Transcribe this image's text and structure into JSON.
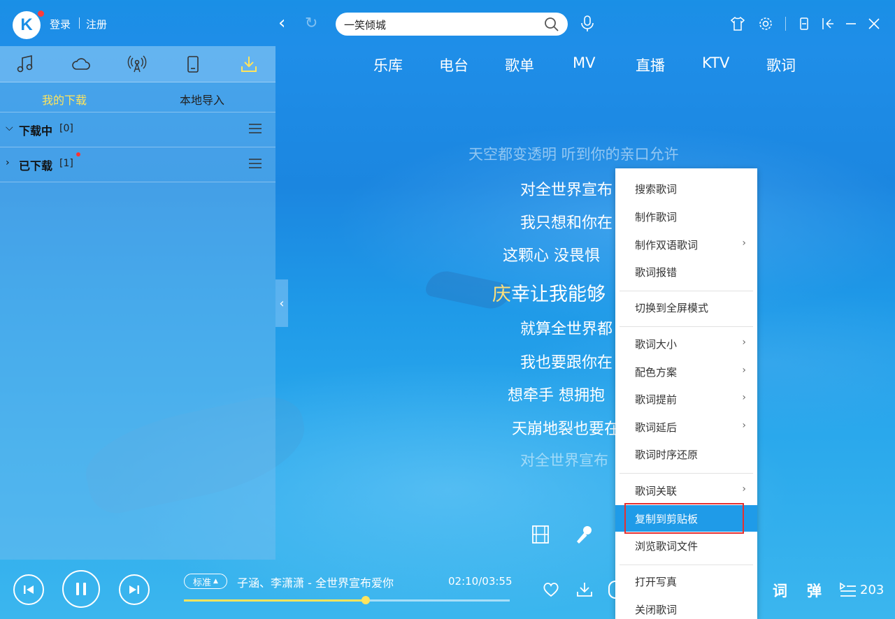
{
  "header": {
    "logo_letter": "K",
    "login": "登录",
    "register": "注册",
    "search": {
      "value": "一笑倾城"
    }
  },
  "left_panel": {
    "tabs": [
      "music-note-icon",
      "cloud-icon",
      "radio-icon",
      "phone-icon",
      "download-icon"
    ],
    "sub_tabs": {
      "my_downloads": "我的下载",
      "local_import": "本地导入"
    },
    "groups": [
      {
        "name": "下载中",
        "count": "[0]"
      },
      {
        "name": "已下载",
        "count": "[1]"
      }
    ]
  },
  "main_nav": [
    "乐库",
    "电台",
    "歌单",
    "MV",
    "直播",
    "KTV",
    "歌词"
  ],
  "lyrics": {
    "line1": "天空都变透明 听到你的亲口允许",
    "line2": "对全世界宣布",
    "line3": "我只想和你在",
    "line4": "这颗心 没畏惧",
    "current_hl": "庆",
    "current_rest": "幸让我能够",
    "line6": "就算全世界都",
    "line7": "我也要跟你在",
    "line8": "想牵手 想拥抱",
    "line9": "天崩地裂也要在",
    "line10": "对全世界宣布"
  },
  "context_menu": {
    "items": [
      "搜索歌词",
      "制作歌词",
      "制作双语歌词",
      "歌词报错",
      "切换到全屏模式",
      "歌词大小",
      "配色方案",
      "歌词提前",
      "歌词延后",
      "歌词时序还原",
      "歌词关联",
      "复制到剪贴板",
      "浏览歌词文件",
      "打开写真",
      "关闭歌词"
    ],
    "highlighted": "复制到剪贴板"
  },
  "player": {
    "quality": "标准",
    "track": "子涵、李潇潇 - 全世界宣布爱你",
    "time": "02:10/03:55",
    "progress": 0.557,
    "lyric_button": "词",
    "danmaku_button": "弹",
    "playlist_count": "203"
  },
  "colors": {
    "accent": "#1a8fe6",
    "highlight": "#ffe45c",
    "menu_active": "#1f9be8",
    "annotation_border": "#e53030"
  }
}
